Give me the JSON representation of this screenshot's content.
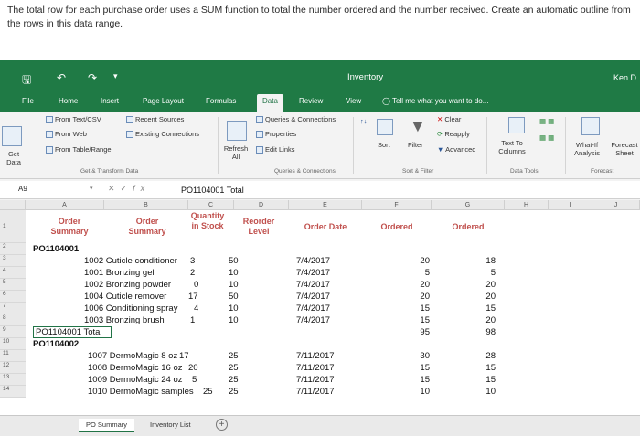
{
  "instruction": "The total row for each purchase order uses a SUM function to total the number ordered and the number received. Create an automatic outline from the rows in this data range.",
  "titlebar": {
    "app_title": "Inventory",
    "user": "Ken D",
    "save_icon": "save-icon",
    "undo_icon": "undo-icon",
    "redo_icon": "redo-icon"
  },
  "tabs": [
    "File",
    "Home",
    "Insert",
    "Page Layout",
    "Formulas",
    "Data",
    "Review",
    "View"
  ],
  "tell_me": "Tell me what you want to do...",
  "ribbon": {
    "get_data": "Get Data",
    "from_text": "From Text/CSV",
    "from_web": "From Web",
    "from_table": "From Table/Range",
    "recent_sources": "Recent Sources",
    "existing_connections": "Existing Connections",
    "group_get_transform": "Get & Transform Data",
    "refresh_all": "Refresh All",
    "queries_connections": "Queries & Connections",
    "properties": "Properties",
    "edit_links": "Edit Links",
    "group_queries": "Queries & Connections",
    "sort": "Sort",
    "filter": "Filter",
    "clear": "Clear",
    "reapply": "Reapply",
    "advanced": "Advanced",
    "group_sort_filter": "Sort & Filter",
    "text_to_columns": "Text To Columns",
    "group_data_tools": "Data Tools",
    "what_if": "What-If Analysis",
    "forecast_sheet": "Forecast Sheet",
    "group_forecast": "Forecast"
  },
  "formula_bar": {
    "name_box": "A9",
    "value": "PO1104001 Total"
  },
  "columns": [
    "A",
    "B",
    "C",
    "D",
    "E",
    "F",
    "G",
    "H",
    "I",
    "J"
  ],
  "headers": {
    "a": "Order Summary",
    "b": "Order Summary",
    "c": "Quantity in Stock",
    "d": "Reorder Level",
    "e": "Order Date",
    "f": "Ordered",
    "g": "Ordered"
  },
  "row_numbers": [
    "1",
    "2",
    "3",
    "4",
    "5",
    "6",
    "7",
    "8",
    "9",
    "10",
    "11",
    "12",
    "13",
    "14"
  ],
  "po1": "PO1104001",
  "po1_items": [
    {
      "desc": "1002 Cuticle conditioner",
      "qty": "3",
      "reorder": "50",
      "date": "7/4/2017",
      "ordered": "20",
      "received": "18"
    },
    {
      "desc": "1001 Bronzing gel",
      "qty": "2",
      "reorder": "10",
      "date": "7/4/2017",
      "ordered": "5",
      "received": "5"
    },
    {
      "desc": "1002 Bronzing powder",
      "qty": "0",
      "reorder": "10",
      "date": "7/4/2017",
      "ordered": "20",
      "received": "20"
    },
    {
      "desc": "1004 Cuticle remover",
      "qty": "17",
      "reorder": "50",
      "date": "7/4/2017",
      "ordered": "20",
      "received": "20"
    },
    {
      "desc": "1006 Conditioning spray",
      "qty": "4",
      "reorder": "10",
      "date": "7/4/2017",
      "ordered": "15",
      "received": "15"
    },
    {
      "desc": "1003 Bronzing brush",
      "qty": "1",
      "reorder": "10",
      "date": "7/4/2017",
      "ordered": "15",
      "received": "20"
    }
  ],
  "po1_total": {
    "label": "PO1104001 Total",
    "ordered": "95",
    "received": "98"
  },
  "po2": "PO1104002",
  "po2_items": [
    {
      "desc": "1007 DermoMagic 8 oz",
      "qty": "17",
      "reorder": "25",
      "date": "7/11/2017",
      "ordered": "30",
      "received": "28"
    },
    {
      "desc": "1008 DermoMagic 16 oz",
      "qty": "20",
      "reorder": "25",
      "date": "7/11/2017",
      "ordered": "15",
      "received": "15"
    },
    {
      "desc": "1009 DermoMagic 24 oz",
      "qty": "5",
      "reorder": "25",
      "date": "7/11/2017",
      "ordered": "15",
      "received": "15"
    },
    {
      "desc": "1010 DermoMagic samples",
      "qty": "25",
      "reorder": "25",
      "date": "7/11/2017",
      "ordered": "10",
      "received": "10"
    }
  ],
  "sheet_tabs": [
    "PO Summary",
    "Inventory List"
  ],
  "add_sheet": "+"
}
